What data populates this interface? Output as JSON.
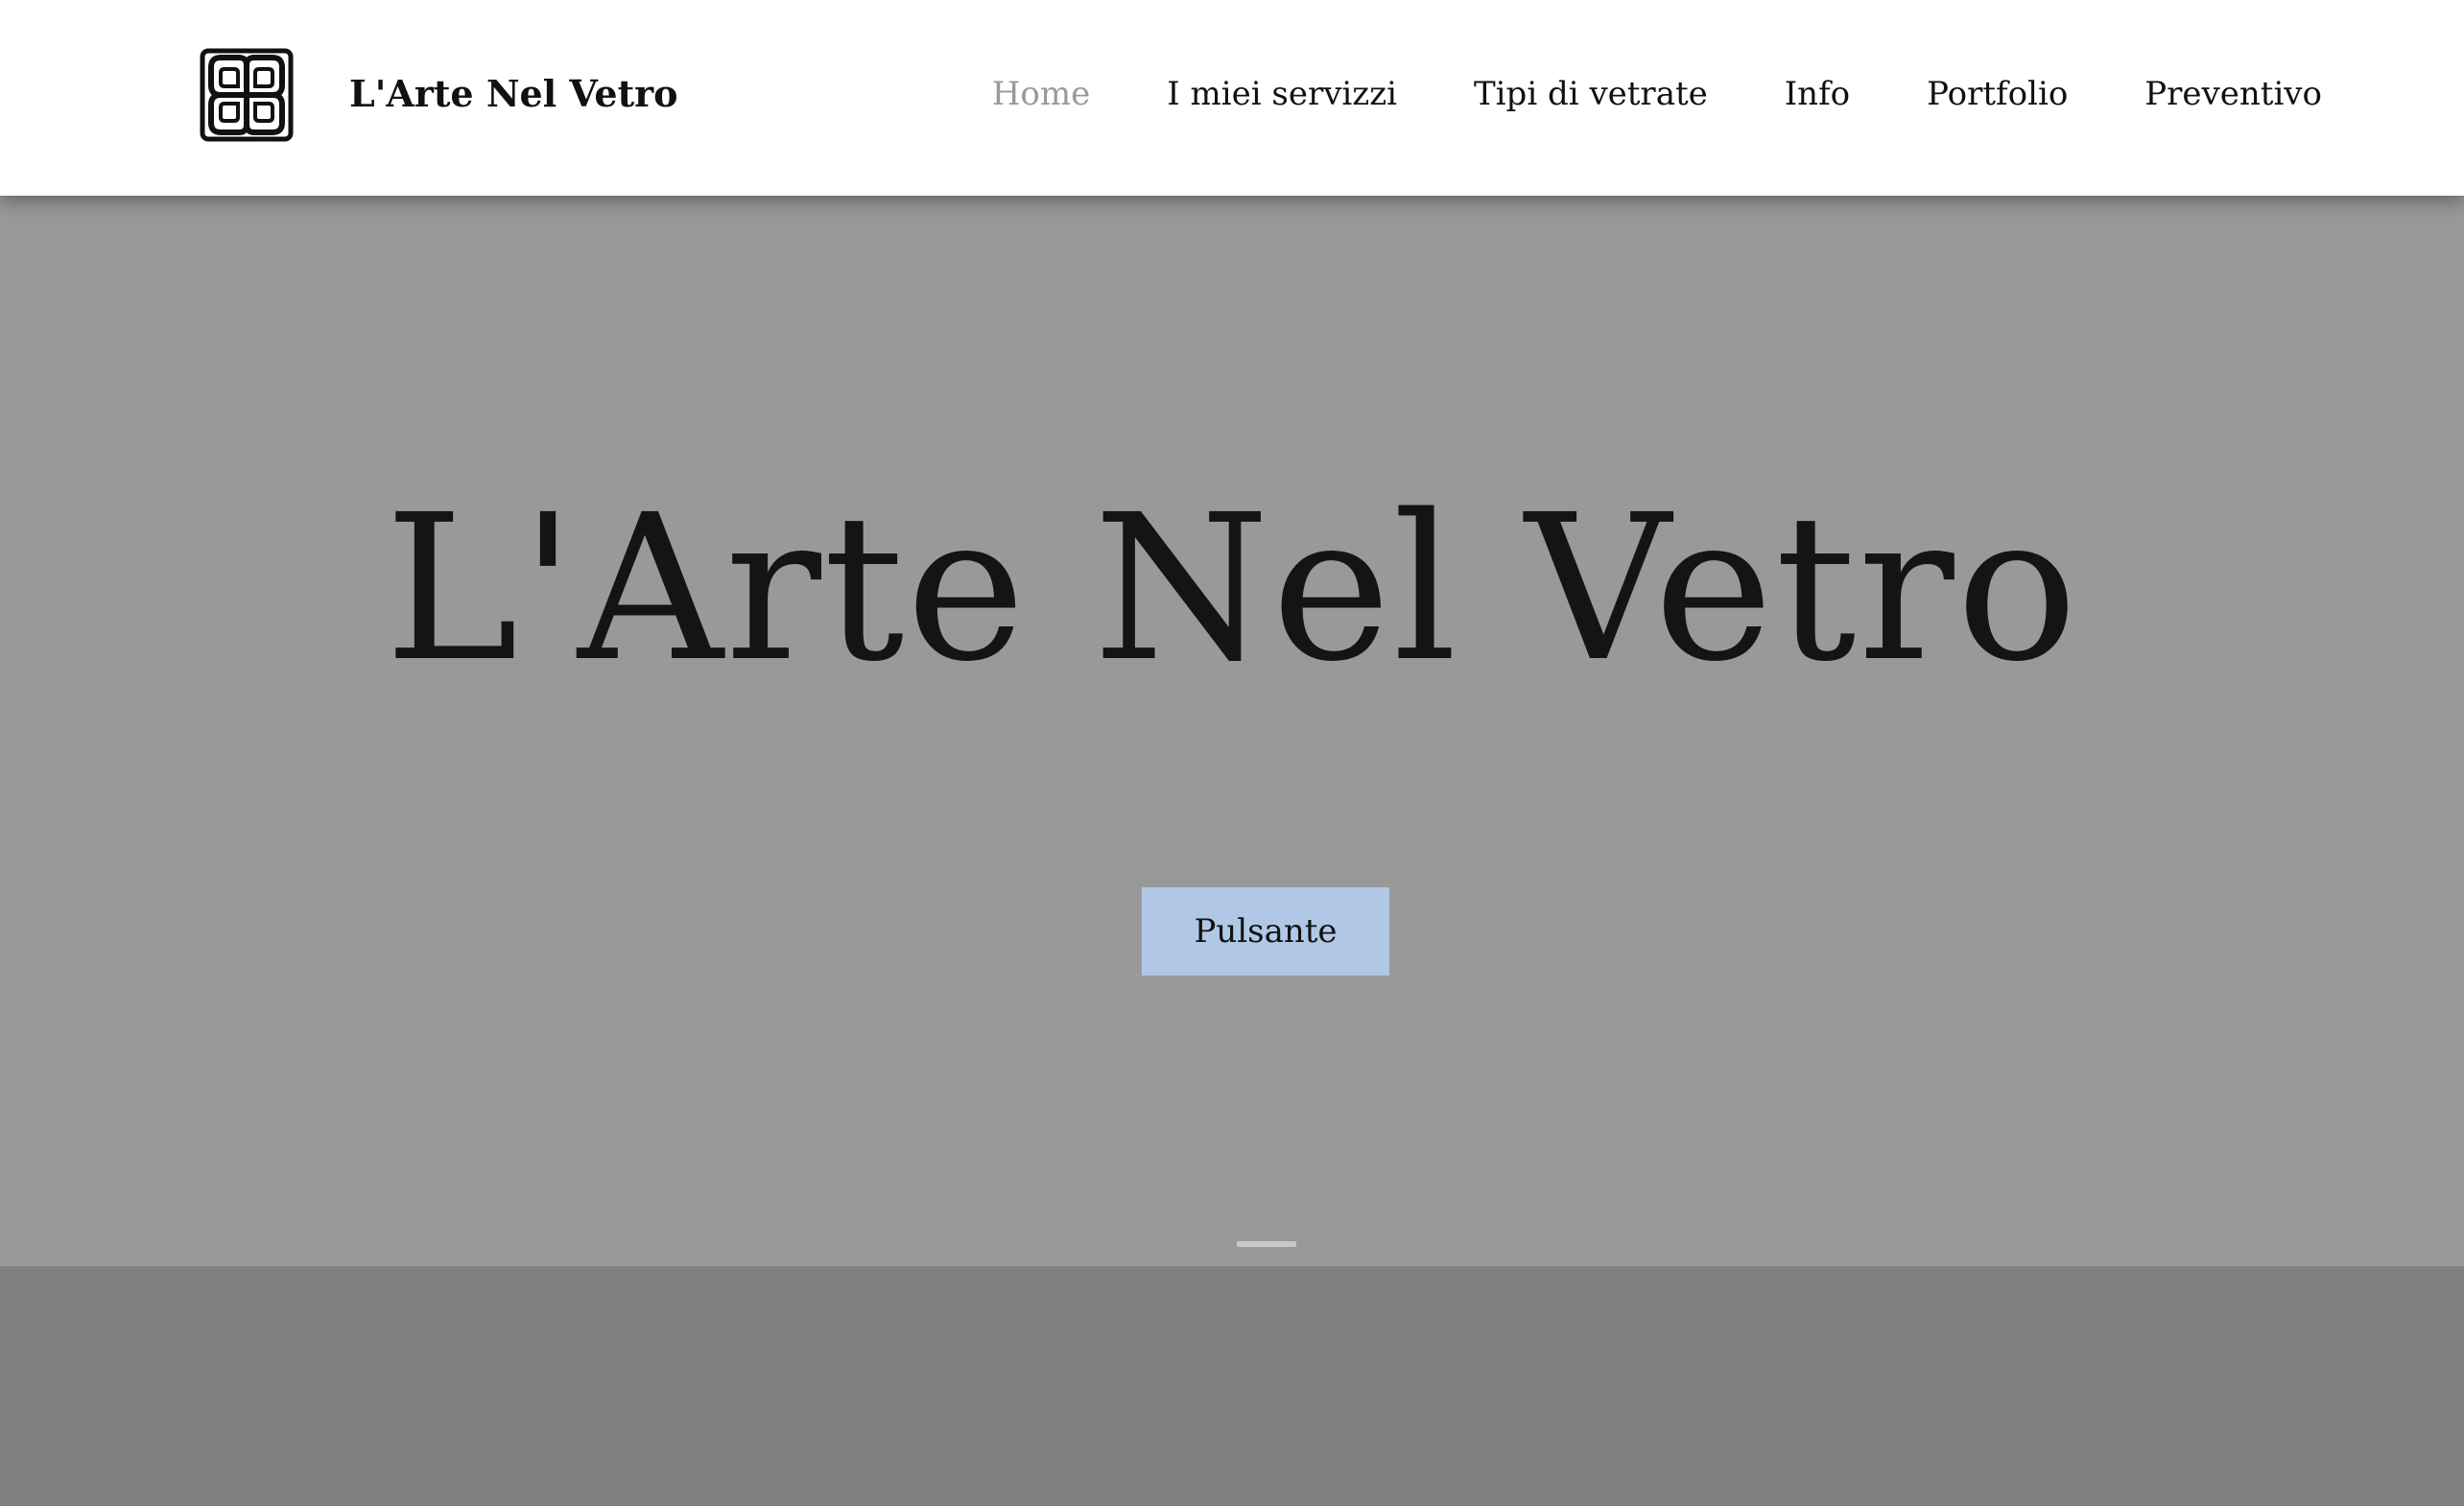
{
  "header": {
    "brand_name": "L'Arte Nel Vetro",
    "logo_icon": "celtic-knot-logo-icon"
  },
  "nav": {
    "items": [
      {
        "label": "Home",
        "active": true
      },
      {
        "label": "I miei servizzi",
        "active": false
      },
      {
        "label": "Tipi di vetrate",
        "active": false
      },
      {
        "label": "Info",
        "active": false
      },
      {
        "label": "Portfolio",
        "active": false
      },
      {
        "label": "Preventivo",
        "active": false
      }
    ]
  },
  "hero": {
    "title": "L'Arte Nel Vetro",
    "button_label": "Pulsante"
  },
  "colors": {
    "header_bg": "#ffffff",
    "hero_bg": "#999999",
    "lower_bg": "#808080",
    "button_bg": "#b0c8e6",
    "nav_active": "#9a9a9a",
    "text": "#111111"
  }
}
